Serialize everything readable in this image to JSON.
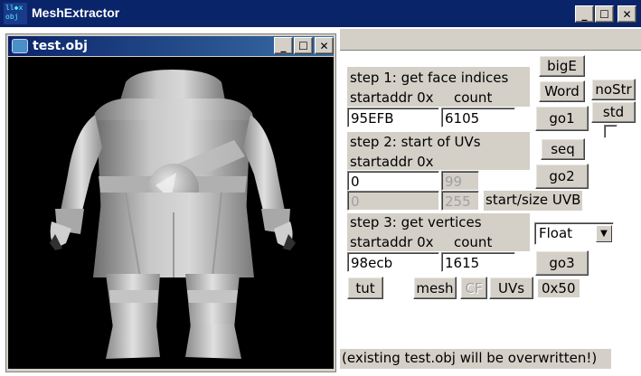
{
  "window": {
    "icon_text": "ll◆x\nobj",
    "title": "MeshExtractor",
    "minimize": "_",
    "maximize": "☐",
    "close": "✕"
  },
  "child_window": {
    "title": "test.obj",
    "minimize": "_",
    "maximize": "☐",
    "close": "✕"
  },
  "step1": {
    "heading": "step 1: get face indices",
    "startaddr_label": "startaddr 0x",
    "count_label": "count",
    "startaddr_value": "95EFB",
    "count_value": "6105"
  },
  "step2": {
    "heading": "step 2: start of UVs",
    "startaddr_label": "startaddr 0x",
    "startaddr_value": "0",
    "field_99": "99",
    "uvb_start": "0",
    "uvb_size": "255",
    "uvb_label": "start/size UVB"
  },
  "step3": {
    "heading": "step 3: get vertices",
    "startaddr_label": "startaddr 0x",
    "count_label": "count",
    "startaddr_value": "98ecb",
    "count_value": "1615",
    "format_selected": "Float"
  },
  "buttons": {
    "bigE": "bigE",
    "word": "Word",
    "noStr": "noStr",
    "std": "std",
    "go1": "go1",
    "seq": "seq",
    "go2": "go2",
    "go3": "go3",
    "tut": "tut",
    "mesh": "mesh",
    "cf": "CF",
    "uvs": "UVs"
  },
  "stride_value": "0x50",
  "status": "(existing test.obj will be overwritten!)",
  "colors": {
    "titlebar": "#0a246a",
    "child_title_start": "#0a246a",
    "child_title_end": "#3a6ea5",
    "face": "#d4d0c8",
    "viewport": "#000000"
  }
}
